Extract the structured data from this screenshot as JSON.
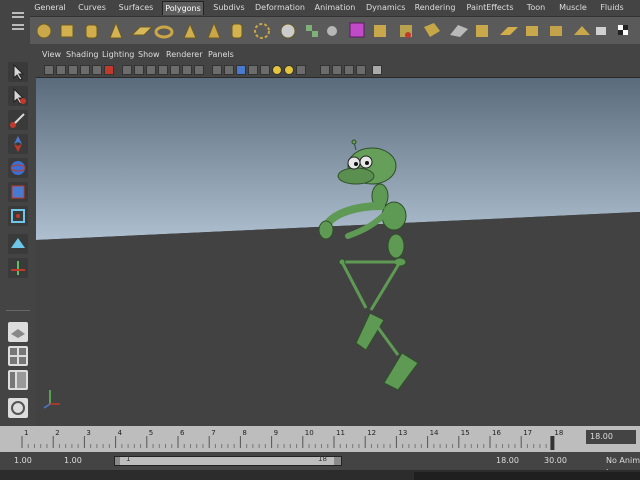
{
  "shelf": {
    "tabs": [
      "General",
      "Curves",
      "Surfaces",
      "Polygons",
      "Subdivs",
      "Deformation",
      "Animation",
      "Dynamics",
      "Rendering",
      "PaintEffects",
      "Toon",
      "Muscle",
      "Fluids"
    ],
    "active_tab": "Polygons",
    "icons": [
      "poly-sphere-icon",
      "poly-cube-icon",
      "poly-cylinder-icon",
      "poly-cone-icon",
      "poly-plane-icon",
      "poly-torus-icon",
      "poly-prism-icon",
      "poly-pyramid-icon",
      "poly-pipe-icon",
      "poly-helix-icon",
      "poly-soccer-ball-icon",
      "combine-icon",
      "separate-icon",
      "extract-icon",
      "boolean-union-icon",
      "smooth-icon",
      "platonic-icon",
      "append-polygon-icon",
      "split-polygon-icon",
      "extrude-face-icon",
      "bridge-icon",
      "merge-icon",
      "bevel-icon",
      "cut-faces-icon",
      "wedge-icon",
      "poke-icon",
      "planar-map-icon",
      "cylindrical-map-icon",
      "spherical-map-icon",
      "uv-editor-icon",
      "render-icon",
      "checker-icon"
    ]
  },
  "panel": {
    "menus": [
      "View",
      "Shading",
      "Lighting",
      "Show",
      "Renderer",
      "Panels"
    ]
  },
  "timeslider": {
    "ticks": [
      "1",
      "2",
      "3",
      "4",
      "5",
      "6",
      "7",
      "8",
      "9",
      "10",
      "11",
      "12",
      "13",
      "14",
      "15",
      "16",
      "17",
      "18"
    ],
    "current_frame": "18",
    "current_frame_field": "18.00"
  },
  "range": {
    "start_time": "1.00",
    "playback_start": "1.00",
    "slider_min": "1",
    "slider_max": "18",
    "playback_end": "18.00",
    "end_time": "30.00",
    "anim_layer": "No Anim L"
  },
  "colors": {
    "accent": "#5e9a54",
    "viewport_sky_top": "#5a6b7b",
    "viewport_sky_bottom": "#aebfd0",
    "ground": "#424242"
  }
}
